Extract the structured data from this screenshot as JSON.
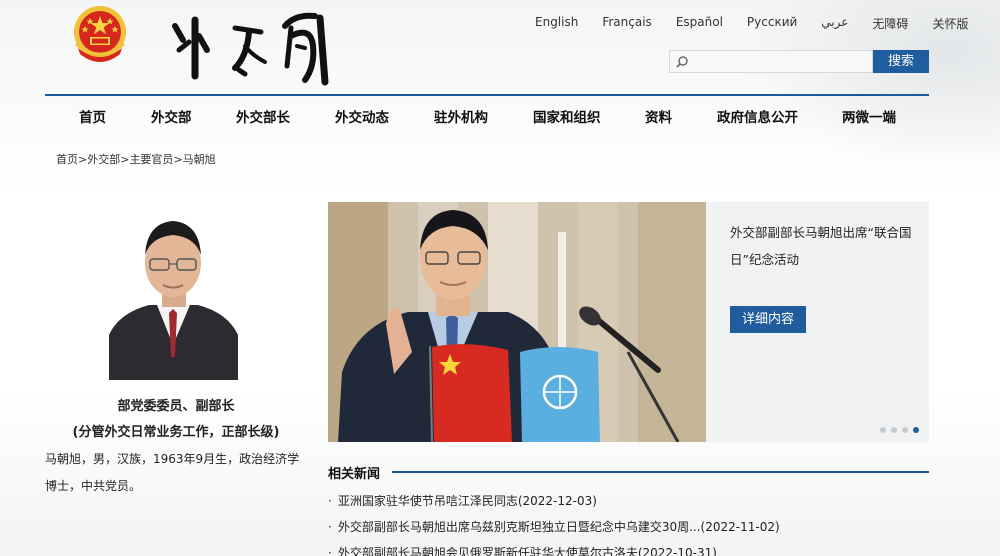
{
  "header": {
    "languages": [
      "English",
      "Français",
      "Español",
      "Русский",
      "عربي",
      "无障碍",
      "关怀版"
    ],
    "search": {
      "placeholder": "",
      "button_label": "搜索"
    }
  },
  "nav": [
    "首页",
    "外交部",
    "外交部长",
    "外交动态",
    "驻外机构",
    "国家和组织",
    "资料",
    "政府信息公开",
    "两微一端"
  ],
  "breadcrumb": [
    "首页",
    "外交部",
    "主要官员",
    "马朝旭"
  ],
  "profile": {
    "title_line1": "部党委委员、副部长",
    "title_line2": "(分管外交日常业务工作，正部长级)",
    "bio": "马朝旭，男，汉族，1963年9月生，政治经济学博士，中共党员。"
  },
  "slider": {
    "caption": "外交部副部长马朝旭出席“联合国日”纪念活动",
    "detail_label": "详细内容",
    "slide_count": 4,
    "active_slide": 4
  },
  "news": {
    "heading": "相关新闻",
    "items": [
      "亚洲国家驻华使节吊唁江泽民同志(2022-12-03)",
      "外交部副部长马朝旭出席乌兹别克斯坦独立日暨纪念中乌建交30周...(2022-11-02)",
      "外交部副部长马朝旭会见俄罗斯新任驻华大使莫尔古洛夫(2022-10-31)"
    ]
  },
  "colors": {
    "accent": "#1f5d9e",
    "rule": "#1e5a98"
  }
}
